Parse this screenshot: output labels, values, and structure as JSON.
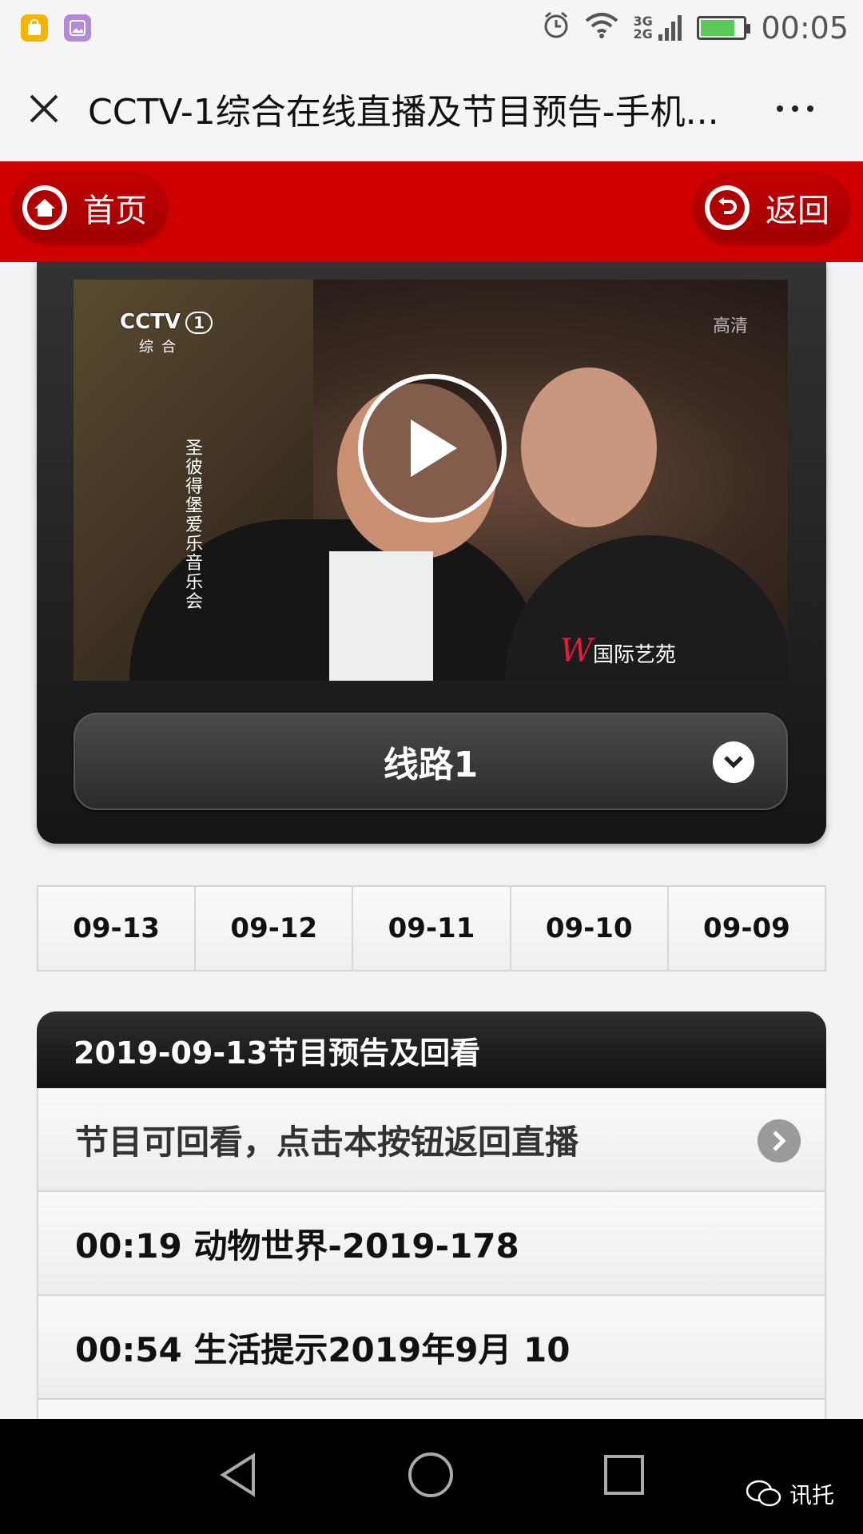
{
  "status_bar": {
    "time": "00:05",
    "network": "3G 2G"
  },
  "title_bar": {
    "title": "CCTV-1综合在线直播及节目预告-手机..."
  },
  "nav": {
    "home_label": "首页",
    "back_label": "返回"
  },
  "video": {
    "channel_logo": "CCTV",
    "channel_number": "1",
    "channel_sub": "综合",
    "hd_mark": "高清",
    "vertical_caption": "圣彼得堡爱乐音乐会",
    "brand_caption": "国际艺苑",
    "brand_w": "W"
  },
  "route": {
    "selected": "线路1"
  },
  "date_tabs": [
    "09-13",
    "09-12",
    "09-11",
    "09-10",
    "09-09"
  ],
  "schedule": {
    "header": "2019-09-13节目预告及回看",
    "items": [
      "节目可回看，点击本按钮返回直播",
      "00:19 动物世界-2019-178",
      "00:54 生活提示2019年9月 10"
    ]
  },
  "watermark": {
    "text": "讯托"
  },
  "colors": {
    "nav_red": "#d00000",
    "dark_panel": "#151515"
  }
}
